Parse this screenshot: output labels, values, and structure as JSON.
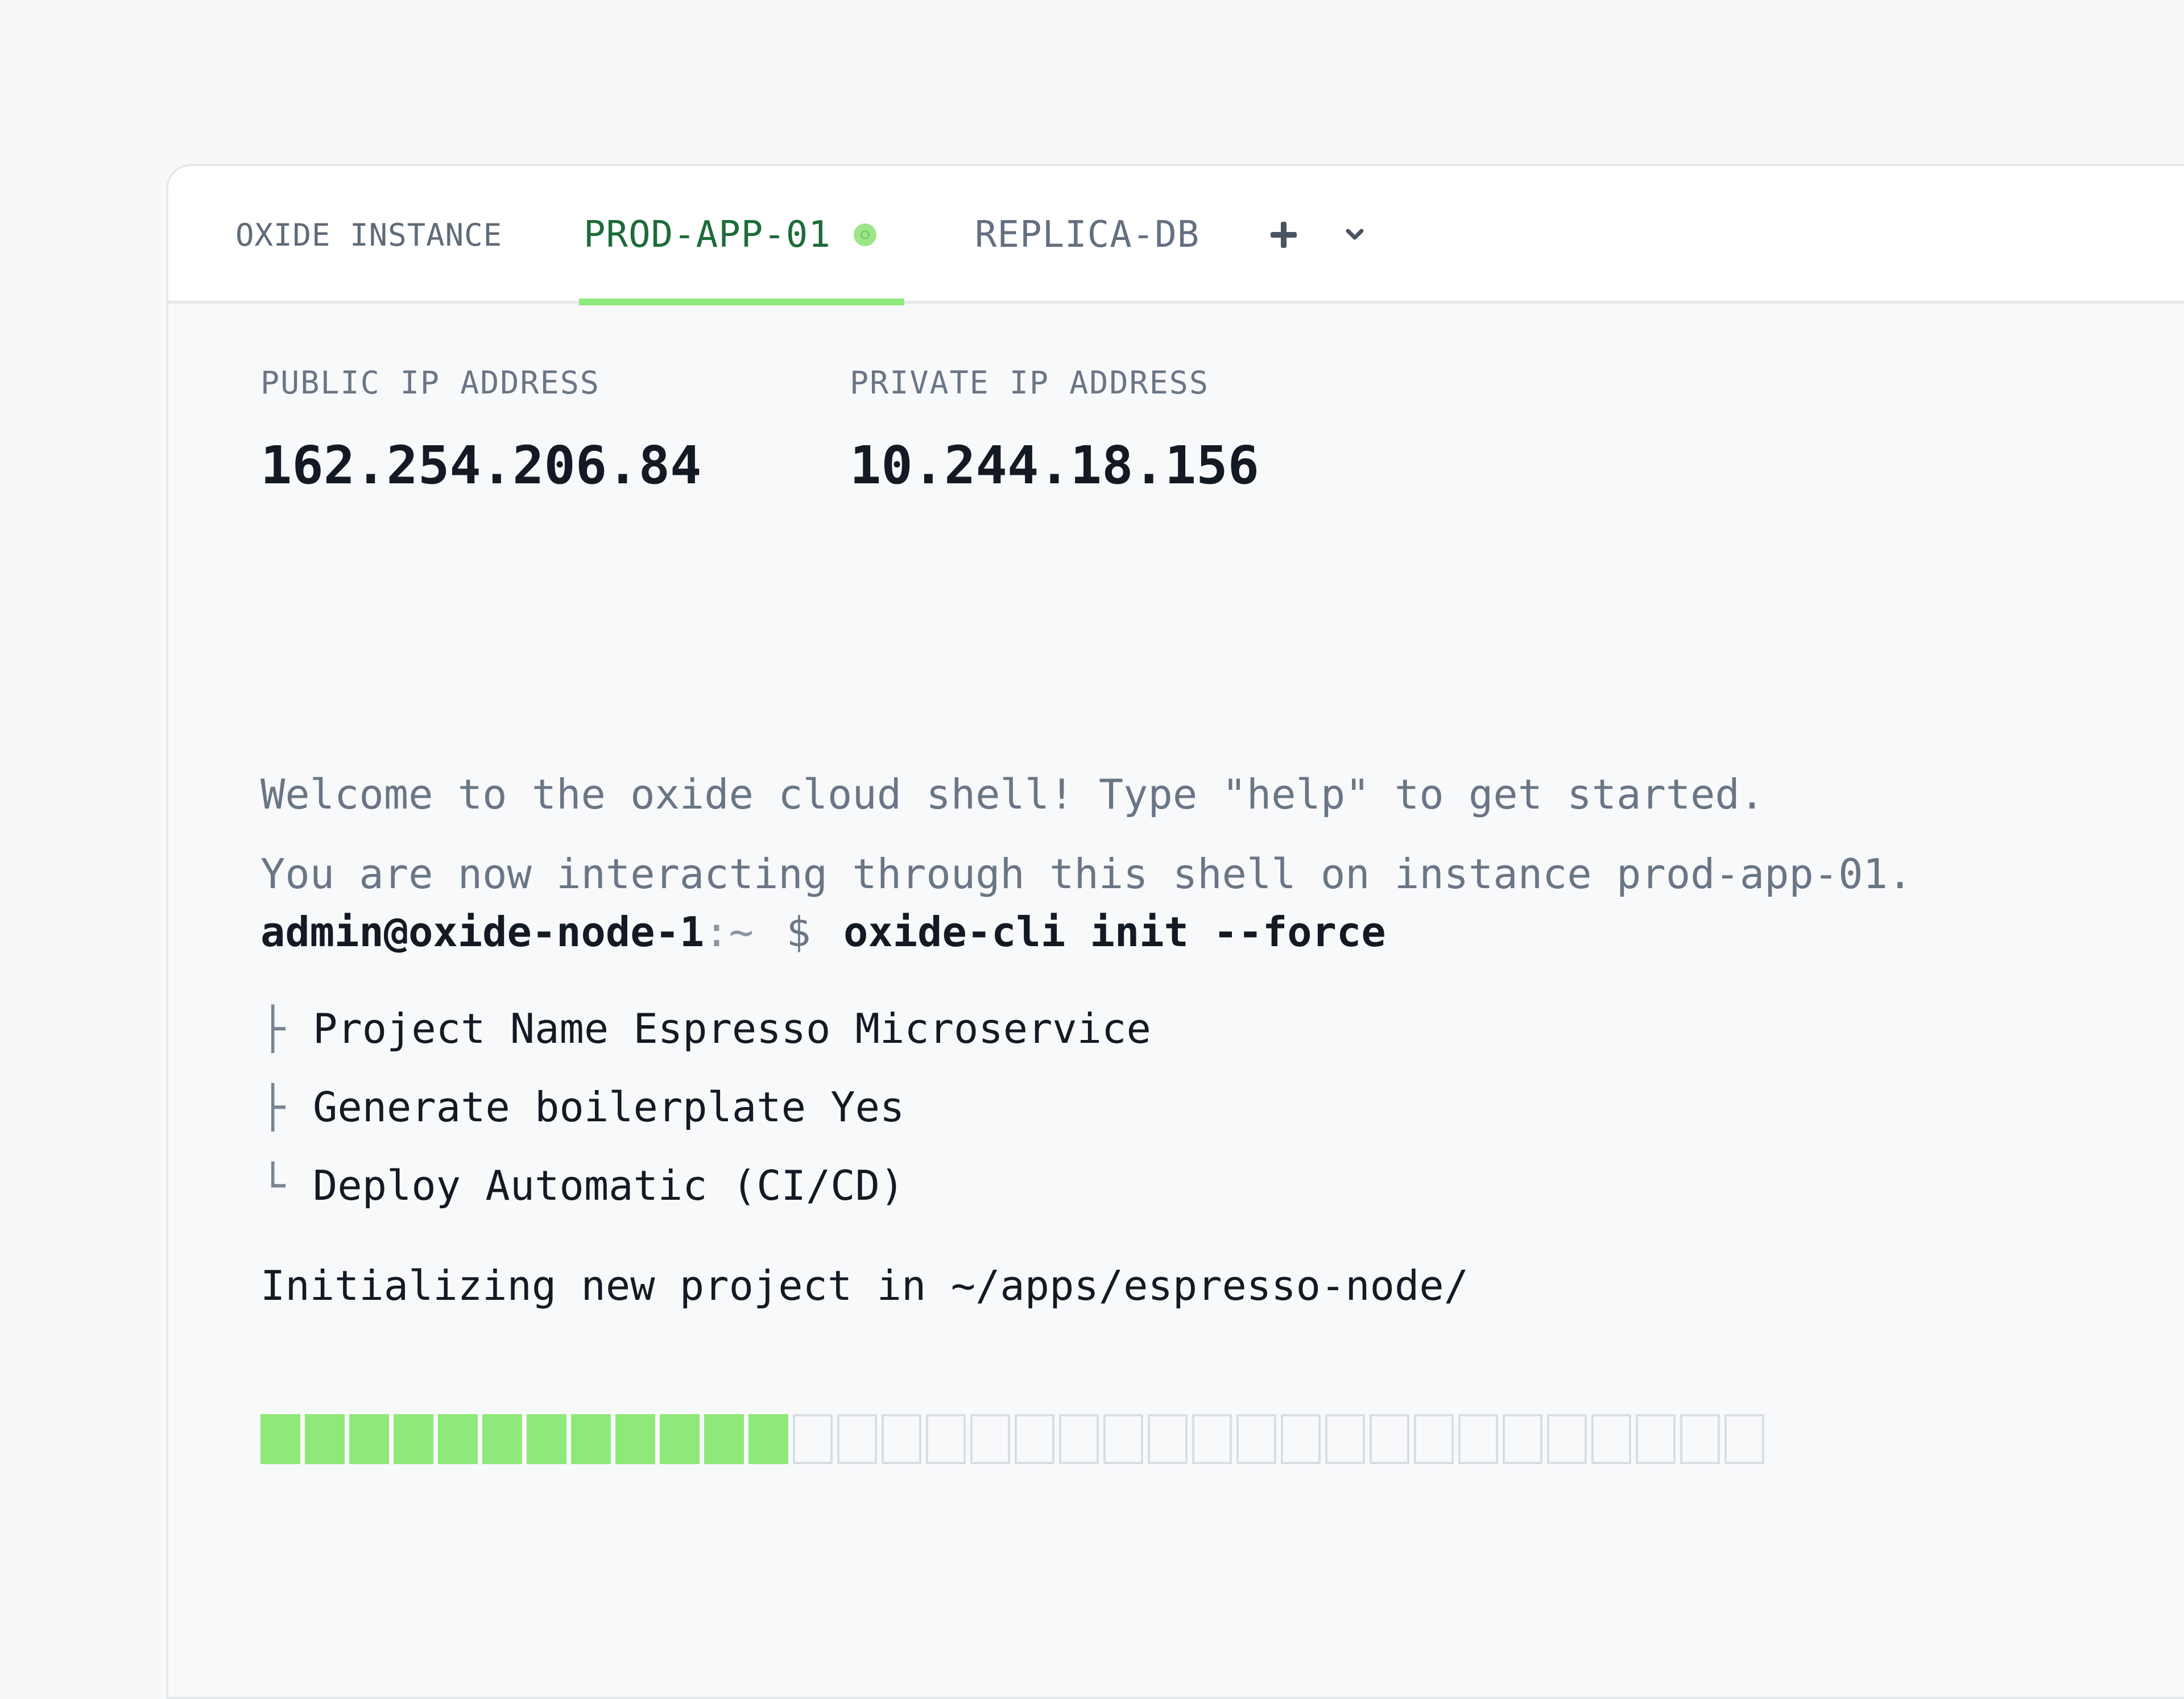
{
  "tabs": [
    {
      "label": "OXIDE INSTANCE"
    },
    {
      "label": "PROD-APP-01",
      "active": true,
      "status": "online"
    },
    {
      "label": "REPLICA-DB"
    }
  ],
  "tab_actions": {
    "add_icon": "plus-icon",
    "menu_icon": "chevron-down-icon"
  },
  "addresses": {
    "public_label": "PUBLIC IP ADDRESS",
    "public_value": "162.254.206.84",
    "private_label": "PRIVATE IP ADDRESS",
    "private_value": "10.244.18.156"
  },
  "welcome": {
    "line1": "Welcome to the oxide cloud shell! Type \"help\" to get started.",
    "line2": "You are now interacting through this shell on instance prod-app-01."
  },
  "prompt": {
    "user_host": "admin@oxide-node-1",
    "path": ":~",
    "dollar": "$",
    "command": "oxide-cli init --force"
  },
  "tree": [
    {
      "glyph": "├",
      "text": "Project Name Espresso Microservice"
    },
    {
      "glyph": "├",
      "text": "Generate boilerplate Yes"
    },
    {
      "glyph": "└",
      "text": "Deploy Automatic (CI/CD)"
    }
  ],
  "init_message": "Initializing new project in ~/apps/espresso-node/",
  "progress": {
    "filled_cells": 12,
    "total_cells": 34
  },
  "colors": {
    "accent_green": "#8fe87a",
    "active_tab_text": "#1d6b3a",
    "muted_text": "#6a7685"
  }
}
